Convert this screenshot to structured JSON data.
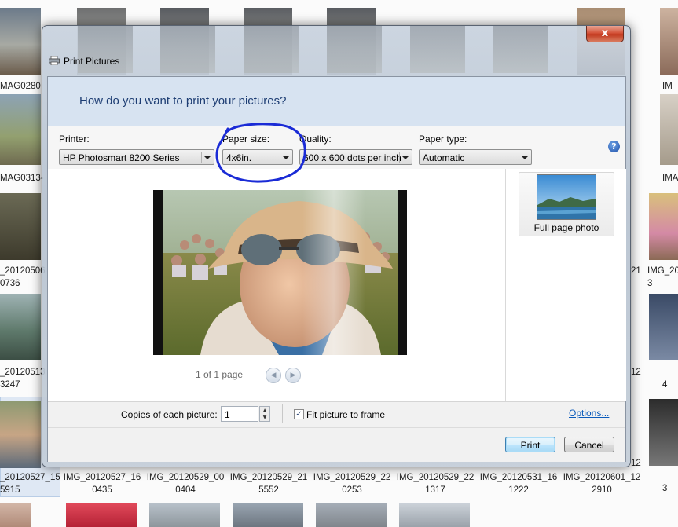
{
  "window": {
    "title": "Print Pictures",
    "close_label": "x",
    "heading": "How do you want to print your pictures?"
  },
  "options": {
    "printer": {
      "label": "Printer:",
      "value": "HP Photosmart 8200 Series"
    },
    "paper_size": {
      "label": "Paper size:",
      "value": "4x6in."
    },
    "quality": {
      "label": "Quality:",
      "value": "600 x 600 dots per inch"
    },
    "paper_type": {
      "label": "Paper type:",
      "value": "Automatic"
    },
    "help_label": "?"
  },
  "preview": {
    "page_info": "1 of 1 page",
    "prev_icon": "left-arrow",
    "next_icon": "right-arrow"
  },
  "layouts": [
    {
      "label": "Full page photo",
      "selected": true
    }
  ],
  "bottom": {
    "copies_label": "Copies of each picture:",
    "copies_value": "1",
    "fit_label": "Fit picture to frame",
    "fit_checked": true,
    "options_link": "Options...",
    "print_label": "Print",
    "cancel_label": "Cancel"
  },
  "background_files": {
    "left_partial": [
      "MAG0280",
      "MAG0313-",
      "_20120506\n0736",
      "_20120513\n3247"
    ],
    "right_partial": [
      "IM",
      "IMA",
      "21",
      "IMG_2012\n3",
      "12",
      "4",
      "12",
      "3"
    ],
    "bottom_captions": [
      "_20120527_15\n5915",
      "IMG_20120527_16\n0435",
      "IMG_20120529_00\n0404",
      "IMG_20120529_21\n5552",
      "IMG_20120529_22\n0253",
      "IMG_20120529_22\n1317",
      "IMG_20120531_16\n1222",
      "IMG_20120601_12\n2910"
    ]
  },
  "colors": {
    "header_band": "#d7e3f1",
    "heading_text": "#1d3d73",
    "annotation_circle": "#1a2bd6",
    "link": "#0b5bbb"
  }
}
